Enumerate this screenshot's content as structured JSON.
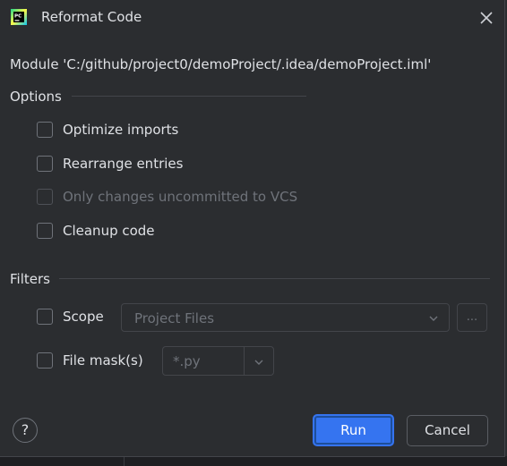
{
  "dialog": {
    "title": "Reformat Code",
    "app_icon_text": "PC",
    "module_label": "Module 'C:/github/project0/demoProject/.idea/demoProject.iml'"
  },
  "options": {
    "title": "Options",
    "optimize_imports": {
      "label": "Optimize imports",
      "checked": false,
      "enabled": true
    },
    "rearrange_entries": {
      "label": "Rearrange entries",
      "checked": false,
      "enabled": true
    },
    "only_vcs_changes": {
      "label": "Only changes uncommitted to VCS",
      "checked": false,
      "enabled": false
    },
    "cleanup_code": {
      "label": "Cleanup code",
      "checked": false,
      "enabled": true
    }
  },
  "filters": {
    "title": "Filters",
    "scope": {
      "label": "Scope",
      "checked": false,
      "value": "Project Files",
      "browse_label": "..."
    },
    "file_mask": {
      "label": "File mask(s)",
      "checked": false,
      "value": "*.py"
    }
  },
  "buttons": {
    "help_label": "?",
    "run_label": "Run",
    "cancel_label": "Cancel"
  },
  "colors": {
    "background": "#2b2d30",
    "accent": "#3574f0",
    "text": "#dfe1e5",
    "disabled_text": "#6f737a"
  },
  "icons": {
    "app": "pycharm-icon",
    "close": "close-icon",
    "dropdown": "chevron-down-icon",
    "help": "help-icon"
  }
}
